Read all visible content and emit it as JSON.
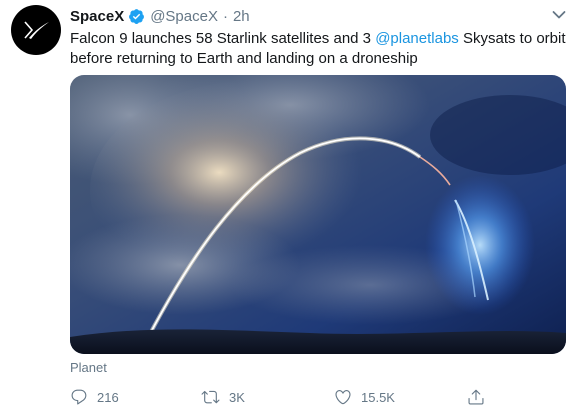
{
  "tweet": {
    "author_name": "SpaceX",
    "author_handle": "@SpaceX",
    "separator": "·",
    "time": "2h",
    "text_part1": "Falcon 9 launches 58 Starlink satellites and 3 ",
    "mention": "@planetlabs",
    "text_part2": " Skysats to orbit before returning to Earth and landing on a droneship",
    "media_credit": "Planet"
  },
  "actions": {
    "reply_count": "216",
    "retweet_count": "3K",
    "like_count": "15.5K"
  },
  "colors": {
    "accent": "#1b95e0",
    "verified": "#1da1f2",
    "muted": "#657786"
  }
}
